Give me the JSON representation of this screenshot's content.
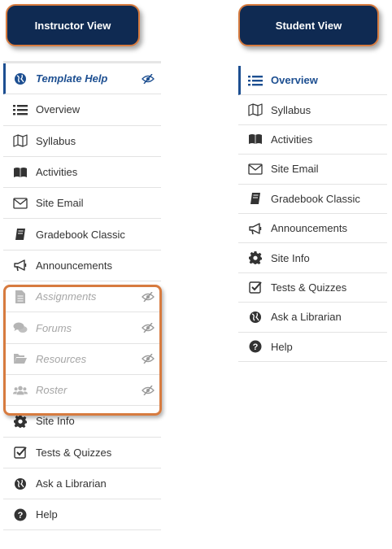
{
  "instructor_view": {
    "badge_label": "Instructor View",
    "items": [
      {
        "label": "Template Help",
        "icon": "globe-icon",
        "state": "active",
        "visibility_icon": "eye-slash-icon"
      },
      {
        "label": "Overview",
        "icon": "list-icon"
      },
      {
        "label": "Syllabus",
        "icon": "map-icon"
      },
      {
        "label": "Activities",
        "icon": "book-open-icon"
      },
      {
        "label": "Site Email",
        "icon": "envelope-icon"
      },
      {
        "label": "Gradebook Classic",
        "icon": "gradebook-icon"
      },
      {
        "label": "Announcements",
        "icon": "bullhorn-icon"
      },
      {
        "label": "Assignments",
        "icon": "file-icon",
        "state": "hidden",
        "visibility_icon": "eye-slash-icon"
      },
      {
        "label": "Forums",
        "icon": "comments-icon",
        "state": "hidden",
        "visibility_icon": "eye-slash-icon"
      },
      {
        "label": "Resources",
        "icon": "folder-open-icon",
        "state": "hidden",
        "visibility_icon": "eye-slash-icon"
      },
      {
        "label": "Roster",
        "icon": "users-icon",
        "state": "hidden",
        "visibility_icon": "eye-slash-icon"
      },
      {
        "label": "Site Info",
        "icon": "gear-icon"
      },
      {
        "label": "Tests & Quizzes",
        "icon": "check-square-icon"
      },
      {
        "label": "Ask a Librarian",
        "icon": "globe-icon"
      },
      {
        "label": "Help",
        "icon": "question-circle-icon"
      }
    ]
  },
  "student_view": {
    "badge_label": "Student View",
    "items": [
      {
        "label": "Overview",
        "icon": "list-icon",
        "state": "active"
      },
      {
        "label": "Syllabus",
        "icon": "map-icon"
      },
      {
        "label": "Activities",
        "icon": "book-open-icon"
      },
      {
        "label": "Site Email",
        "icon": "envelope-icon"
      },
      {
        "label": "Gradebook Classic",
        "icon": "gradebook-icon"
      },
      {
        "label": "Announcements",
        "icon": "bullhorn-icon"
      },
      {
        "label": "Site Info",
        "icon": "gear-icon"
      },
      {
        "label": "Tests & Quizzes",
        "icon": "check-square-icon"
      },
      {
        "label": "Ask a Librarian",
        "icon": "globe-icon"
      },
      {
        "label": "Help",
        "icon": "question-circle-icon"
      }
    ]
  },
  "colors": {
    "badge_background": "#0f2a52",
    "highlight_border": "#d77b3f",
    "active_accent": "#1d4f91",
    "hidden_text": "#a6a6a6",
    "icon_dark": "#333333"
  }
}
